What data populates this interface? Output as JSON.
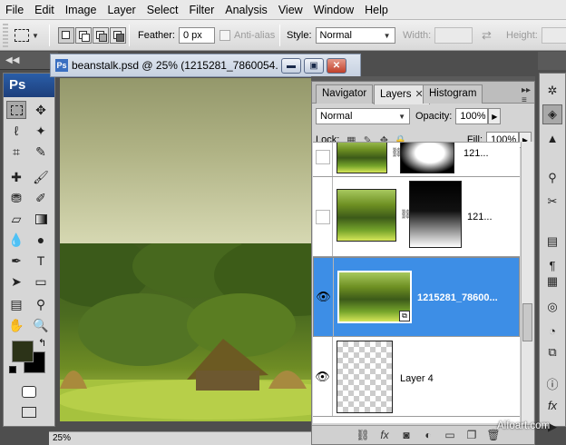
{
  "menubar": {
    "items": [
      "File",
      "Edit",
      "Image",
      "Layer",
      "Select",
      "Filter",
      "Analysis",
      "View",
      "Window",
      "Help"
    ]
  },
  "options": {
    "feather_label": "Feather:",
    "feather_value": "0 px",
    "antialias_label": "Anti-alias",
    "style_label": "Style:",
    "style_value": "Normal",
    "width_label": "Width:",
    "height_label": "Height:"
  },
  "tools": {
    "logo": "Ps"
  },
  "document": {
    "title": "beanstalk.psd @ 25% (1215281_7860054...",
    "zoom": "25%",
    "min_icon": "minimize-icon",
    "restore_icon": "restore-icon",
    "close_icon": "close-icon"
  },
  "layers_panel": {
    "tabs": [
      "Navigator",
      "Layers",
      "Histogram"
    ],
    "active_tab": "Layers",
    "blend_mode": "Normal",
    "opacity_label": "Opacity:",
    "opacity_value": "100%",
    "lock_label": "Lock:",
    "fill_label": "Fill:",
    "fill_value": "100%",
    "layers": [
      {
        "name": "121...",
        "visible": false,
        "has_mask": true
      },
      {
        "name": "121...",
        "visible": false,
        "has_mask": true
      },
      {
        "name": "1215281_78600...",
        "visible": true,
        "selected": true,
        "smart_object": true
      },
      {
        "name": "Layer 4",
        "visible": true,
        "transparent": true
      }
    ]
  },
  "watermark": "Alfoart.com"
}
